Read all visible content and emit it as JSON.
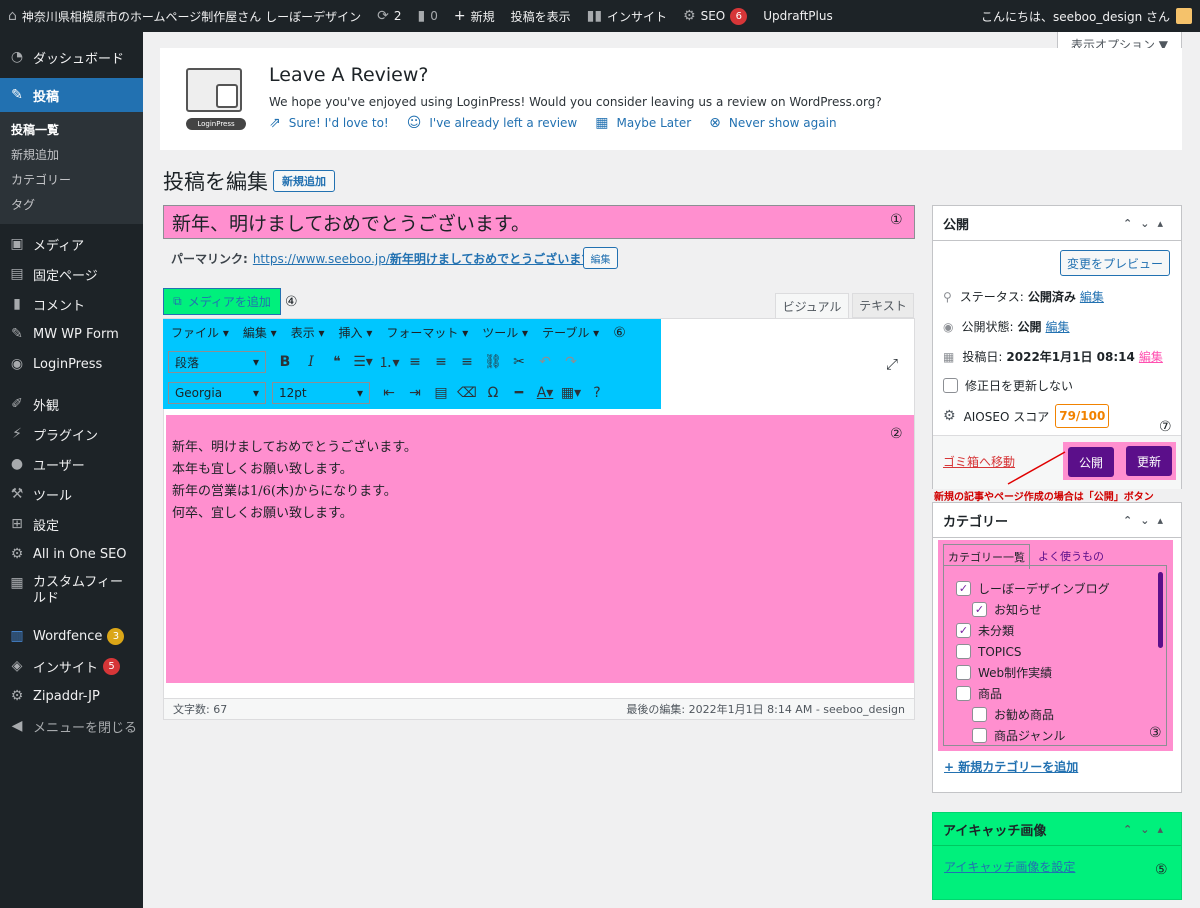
{
  "adminbar": {
    "site_name": "神奈川県相模原市のホームページ制作屋さん しーぼーデザイン",
    "updates": "2",
    "comments": "0",
    "new": "新規",
    "view_post": "投稿を表示",
    "insight": "インサイト",
    "seo": "SEO",
    "seo_badge": "6",
    "updraft": "UpdraftPlus",
    "greeting": "こんにちは、seeboo_design さん"
  },
  "screen_options": "表示オプション ▼",
  "sidebar": {
    "items": [
      {
        "label": "ダッシュボード",
        "icon": "dashboard-icon"
      },
      {
        "label": "投稿",
        "icon": "pin-icon"
      },
      {
        "label": "メディア",
        "icon": "media-icon"
      },
      {
        "label": "固定ページ",
        "icon": "page-icon"
      },
      {
        "label": "コメント",
        "icon": "comment-icon"
      },
      {
        "label": "MW WP Form",
        "icon": "pin-icon"
      },
      {
        "label": "LoginPress",
        "icon": "loginpress-icon"
      },
      {
        "label": "外観",
        "icon": "brush-icon"
      },
      {
        "label": "プラグイン",
        "icon": "plugin-icon"
      },
      {
        "label": "ユーザー",
        "icon": "user-icon"
      },
      {
        "label": "ツール",
        "icon": "wrench-icon"
      },
      {
        "label": "設定",
        "icon": "settings-icon"
      },
      {
        "label": "All in One SEO",
        "icon": "aioseo-icon"
      },
      {
        "label": "カスタムフィールド",
        "icon": "grid-icon"
      },
      {
        "label": "Wordfence",
        "icon": "wordfence-icon",
        "badge": "3"
      },
      {
        "label": "インサイト",
        "icon": "insight-icon",
        "badge": "5"
      },
      {
        "label": "Zipaddr-JP",
        "icon": "gear-icon"
      },
      {
        "label": "メニューを閉じる",
        "icon": "collapse-icon"
      }
    ],
    "sub_items": [
      "投稿一覧",
      "新規追加",
      "カテゴリー",
      "タグ"
    ]
  },
  "notice": {
    "title": "Leave A Review?",
    "text": "We hope you've enjoyed using LoginPress! Would you consider leaving us a review on WordPress.org?",
    "logo_text": "LoginPress",
    "links": [
      "Sure! I'd love to!",
      "I've already left a review",
      "Maybe Later",
      "Never show again"
    ]
  },
  "page": {
    "heading": "投稿を編集",
    "add_new": "新規追加",
    "post_title": "新年、明けましておめでとうございます。",
    "permalink_label": "パーマリンク:",
    "permalink_base": "https://www.seeboo.jp/",
    "permalink_slug": "新年明けましておめでとうございます。",
    "permalink_edit": "編集",
    "add_media": "メディアを追加",
    "tab_visual": "ビジュアル",
    "tab_text": "テキスト",
    "menus": [
      "ファイル ▾",
      "編集 ▾",
      "表示 ▾",
      "挿入 ▾",
      "フォーマット ▾",
      "ツール ▾",
      "テーブル ▾"
    ],
    "format_select": "段落",
    "font_select": "Georgia",
    "size_select": "12pt",
    "content_lines": [
      "新年、明けましておめでとうございます。",
      "本年も宜しくお願い致します。",
      "新年の営業は1/6(木)からになります。",
      "何卒、宜しくお願い致します。"
    ],
    "word_count": "文字数: 67",
    "last_edit": "最後の編集: 2022年1月1日 8:14 AM - seeboo_design"
  },
  "annotations": {
    "n1": "①",
    "n2": "②",
    "n3": "③",
    "n4": "④",
    "n5": "⑤",
    "n6": "⑥",
    "n7": "⑦",
    "publish_note": "新規の記事やページ作成の場合は「公開」ボタン"
  },
  "publish": {
    "title": "公開",
    "preview": "変更をプレビュー",
    "status_label": "ステータス:",
    "status_value": "公開済み",
    "status_edit": "編集",
    "visibility_label": "公開状態:",
    "visibility_value": "公開",
    "visibility_edit": "編集",
    "date_label": "投稿日:",
    "date_value": "2022年1月1日 08:14",
    "date_edit": "編集",
    "no_update_date": "修正日を更新しない",
    "aioseo_label": "AIOSEO スコア",
    "aioseo_score": "79/100",
    "trash": "ゴミ箱へ移動",
    "publish_btn": "公開",
    "update_btn": "更新"
  },
  "categories": {
    "title": "カテゴリー",
    "tab_all": "カテゴリー一覧",
    "tab_popular": "よく使うもの",
    "items": [
      {
        "label": "しーぼーデザインブログ",
        "checked": true,
        "indent": 0
      },
      {
        "label": "お知らせ",
        "checked": true,
        "indent": 1
      },
      {
        "label": "未分類",
        "checked": true,
        "indent": 0
      },
      {
        "label": "TOPICS",
        "checked": false,
        "indent": 0
      },
      {
        "label": "Web制作実績",
        "checked": false,
        "indent": 0
      },
      {
        "label": "商品",
        "checked": false,
        "indent": 0
      },
      {
        "label": "お勧め商品",
        "checked": false,
        "indent": 1
      },
      {
        "label": "商品ジャンル",
        "checked": false,
        "indent": 1
      }
    ],
    "add_new": "+ 新規カテゴリーを追加"
  },
  "featured": {
    "title": "アイキャッチ画像",
    "set_link": "アイキャッチ画像を設定"
  },
  "colors": {
    "accent": "#2271b1",
    "highlight_pink": "#ff8fcf",
    "highlight_cyan": "#00c6ff",
    "highlight_green": "#00f07c",
    "purple_button": "#5b0f8a"
  }
}
